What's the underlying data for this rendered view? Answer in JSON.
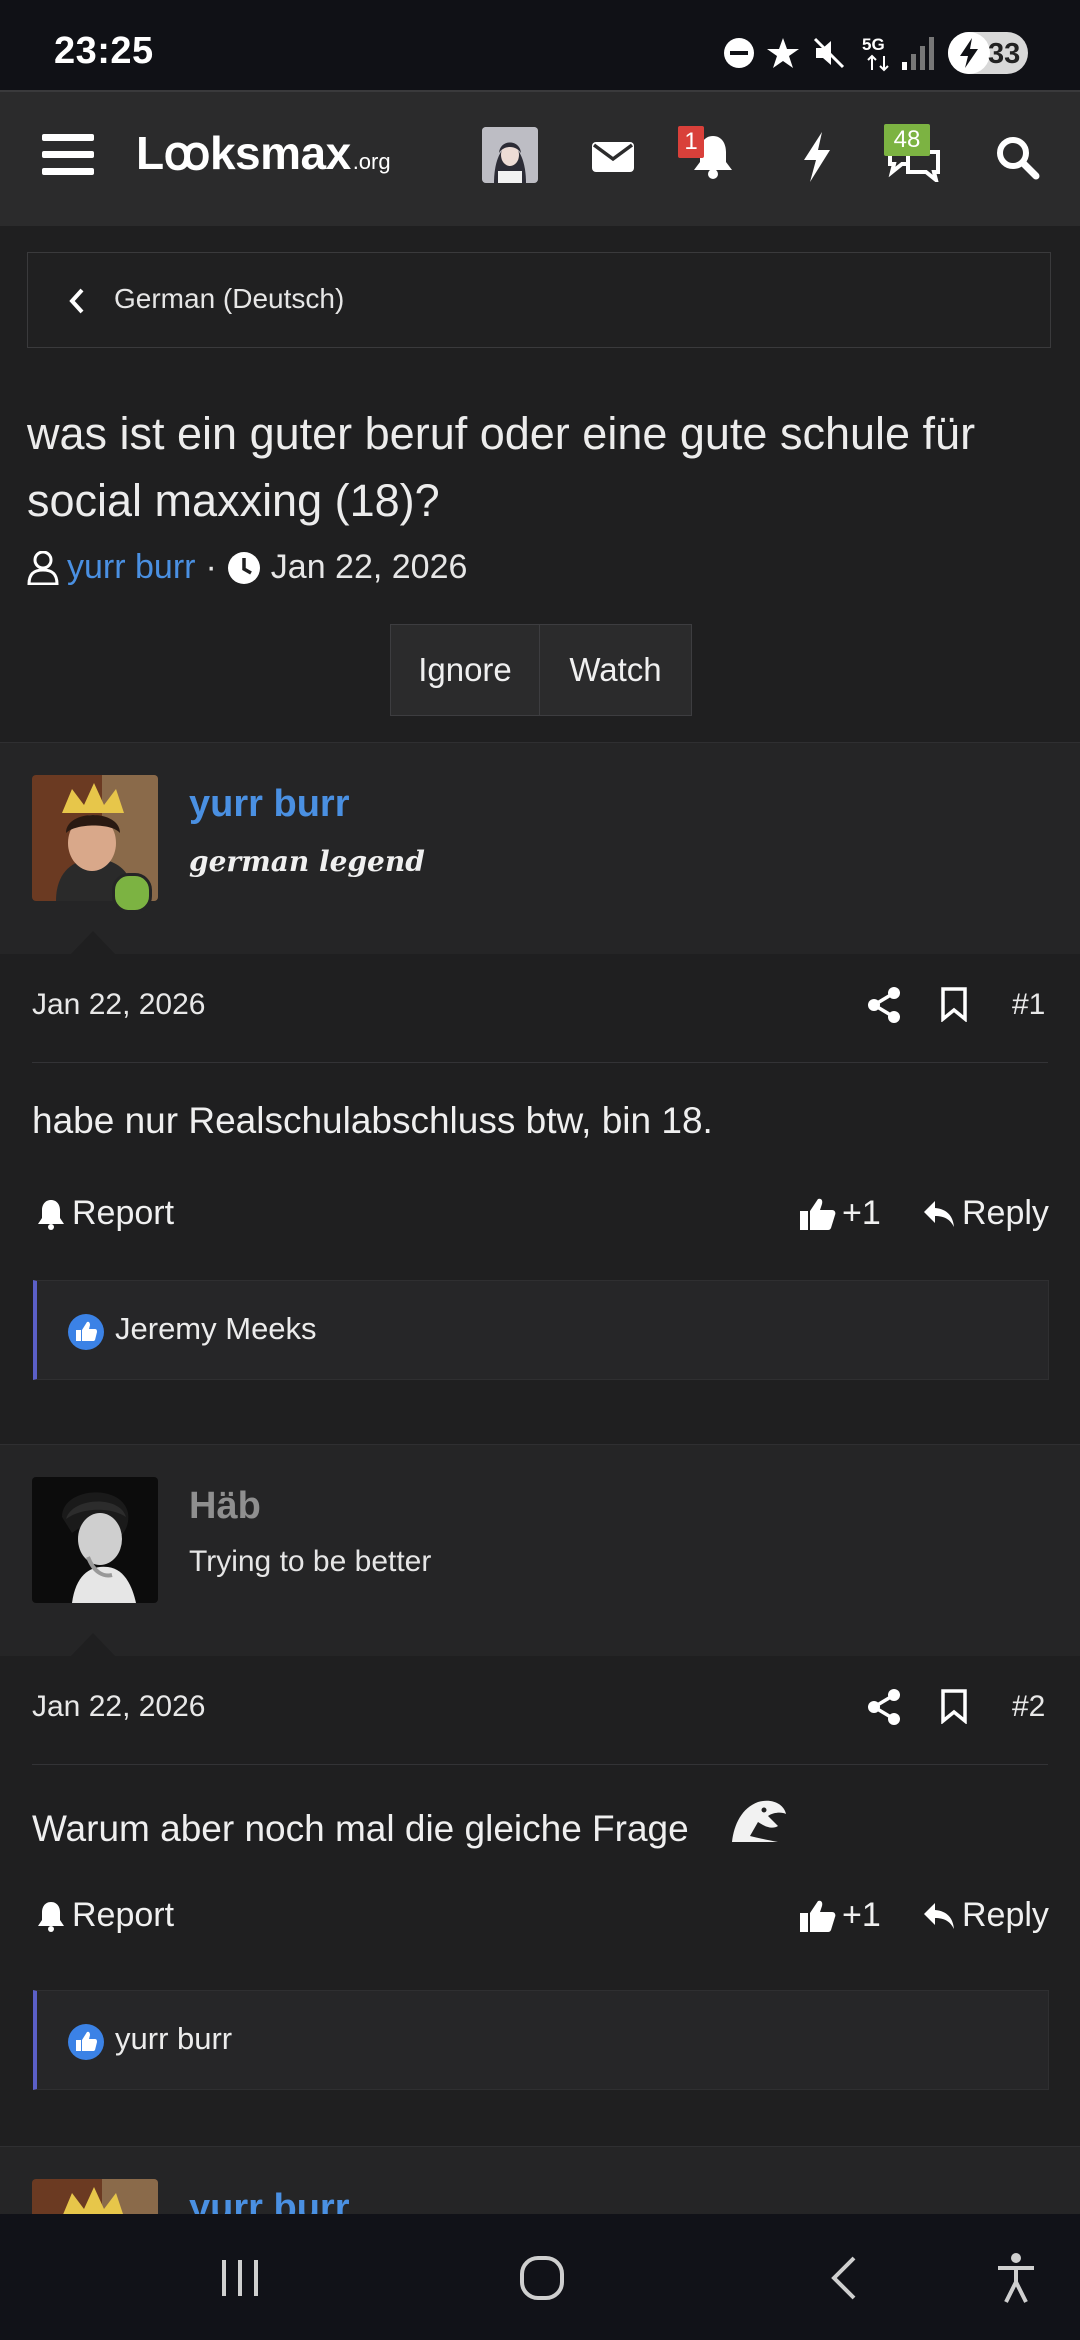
{
  "status_bar": {
    "time": "23:25",
    "network": "5G",
    "battery": "33"
  },
  "header": {
    "logo_main": "Lꝏksmax",
    "logo_suffix": ".org",
    "notification_count": "1",
    "conversation_count": "48"
  },
  "breadcrumb": {
    "label": "German (Deutsch)"
  },
  "thread": {
    "title": "was ist ein guter beruf oder eine gute schule für social maxxing (18)?",
    "author": "yurr burr",
    "separator": "·",
    "date": "Jan 22, 2026",
    "ignore_label": "Ignore",
    "watch_label": "Watch"
  },
  "posts": [
    {
      "username": "yurr burr",
      "user_title": "german legend",
      "date": "Jan 22, 2026",
      "number": "#1",
      "message": "habe nur Realschulabschluss btw, bin 18.",
      "report_label": "Report",
      "like_count": "+1",
      "reply_label": "Reply",
      "liked_by": "Jeremy Meeks",
      "username_color": "#4a90e2",
      "online": true
    },
    {
      "username": "Häb",
      "user_title": "Trying to be better",
      "date": "Jan 22, 2026",
      "number": "#2",
      "message": "Warum aber noch mal die gleiche Frage",
      "report_label": "Report",
      "like_count": "+1",
      "reply_label": "Reply",
      "liked_by": "yurr burr",
      "username_color": "#8f8f8f",
      "online": false
    },
    {
      "username": "yurr burr"
    }
  ],
  "colors": {
    "link": "#4a90e2",
    "accent_bar": "#5b5fc7",
    "online": "#7cb342",
    "alert_badge": "#d9403a",
    "convo_badge": "#7cb342"
  }
}
